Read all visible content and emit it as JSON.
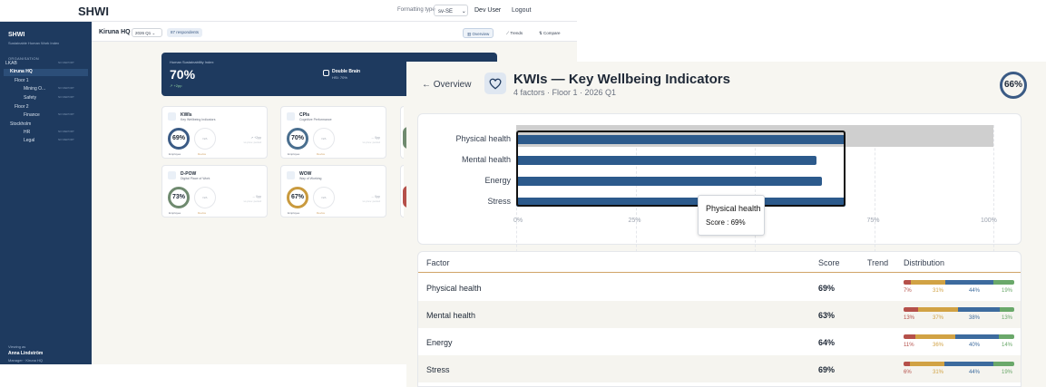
{
  "topbar": {
    "brand": "SHWI",
    "formatting_label": "Formatting type",
    "formatting_value": "sv-SE",
    "user": "Dev User",
    "logout": "Logout"
  },
  "sidebar": {
    "title": "SHWI",
    "subtitle": "Sustainable Human Work Index",
    "section": "ORGANISATION",
    "items": [
      {
        "label": "LKAB",
        "note": "NO REPORT"
      },
      {
        "label": "Kiruna HQ",
        "note": ""
      },
      {
        "label": "Floor 1",
        "note": ""
      },
      {
        "label": "Mining O...",
        "note": "NO REPORT"
      },
      {
        "label": "Safety",
        "note": "NO REPORT"
      },
      {
        "label": "Floor 2",
        "note": ""
      },
      {
        "label": "Finance",
        "note": "NO REPORT"
      },
      {
        "label": "Stockholm",
        "note": ""
      },
      {
        "label": "HR",
        "note": "NO REPORT"
      },
      {
        "label": "Legal",
        "note": "NO REPORT"
      }
    ],
    "viewing_label": "Viewing as",
    "viewer_name": "Anna Lindström",
    "viewer_role": "Manager · Kiruna HQ"
  },
  "subheader": {
    "location": "Kiruna HQ",
    "quarter": "2026 Q1",
    "respondents": "87 respondents",
    "tabs": [
      "Overview",
      "Trends",
      "Compare"
    ]
  },
  "hsi": {
    "label": "Human Sustainability Index",
    "value": "70%",
    "delta": "↗ +2pp",
    "badge_title": "Double Brain",
    "badge_sub": "HSI: 70%"
  },
  "cards": [
    {
      "name": "KWIs",
      "sub": "Key Wellbeing Indicators",
      "score": "69%",
      "device": "N/A",
      "change": "↗ +2pp",
      "prev": "vs prev. period",
      "emp": "Employee",
      "dev": "Device",
      "color": "#3b5b85"
    },
    {
      "name": "CPIs",
      "sub": "Cognitive Performance",
      "score": "70%",
      "device": "N/A",
      "change": "→ 0pp",
      "prev": "vs prev. period",
      "emp": "Employee",
      "dev": "Device",
      "color": "#4a6f8f"
    },
    {
      "name": "D-POW",
      "sub": "Digital Place of Work",
      "score": "73%",
      "device": "N/A",
      "change": "→ 0pp",
      "prev": "vs prev. period",
      "emp": "Employee",
      "dev": "Device",
      "color": "#6f8a6f"
    },
    {
      "name": "WOW",
      "sub": "Way of Working",
      "score": "67%",
      "device": "N/A",
      "change": "→ 0pp",
      "prev": "vs prev. period",
      "emp": "Employee",
      "dev": "Device",
      "color": "#c99a3e"
    }
  ],
  "panel": {
    "back": "← Overview",
    "title": "KWIs — Key Wellbeing Indicators",
    "subtitle": "4 factors · Floor 1 · 2026 Q1",
    "score": "66%"
  },
  "chart_data": {
    "type": "bar",
    "orientation": "horizontal",
    "categories": [
      "Physical health",
      "Mental health",
      "Energy",
      "Stress"
    ],
    "values": [
      69,
      63,
      64,
      69
    ],
    "xlim": [
      0,
      100
    ],
    "xticks": [
      "0%",
      "25%",
      "50%",
      "75%",
      "100%"
    ],
    "highlight": "Physical health",
    "tooltip": {
      "title": "Physical health",
      "text": "Score : 69%"
    },
    "bar_color": "#2c5a8c"
  },
  "table": {
    "headers": [
      "Factor",
      "Score",
      "Trend",
      "Distribution"
    ],
    "rows": [
      {
        "factor": "Physical health",
        "score": "69%",
        "dist": [
          7,
          31,
          44,
          19
        ],
        "labels": [
          "7%",
          "31%",
          "44%",
          "19%"
        ]
      },
      {
        "factor": "Mental health",
        "score": "63%",
        "dist": [
          13,
          37,
          38,
          13
        ],
        "labels": [
          "13%",
          "37%",
          "38%",
          "13%"
        ]
      },
      {
        "factor": "Energy",
        "score": "64%",
        "dist": [
          11,
          36,
          40,
          14
        ],
        "labels": [
          "11%",
          "36%",
          "40%",
          "14%"
        ]
      },
      {
        "factor": "Stress",
        "score": "69%",
        "dist": [
          6,
          31,
          44,
          19
        ],
        "labels": [
          "6%",
          "31%",
          "44%",
          "19%"
        ]
      }
    ],
    "dist_colors": [
      "#b5504a",
      "#d1a244",
      "#3d6b9e",
      "#6aa86a"
    ]
  }
}
